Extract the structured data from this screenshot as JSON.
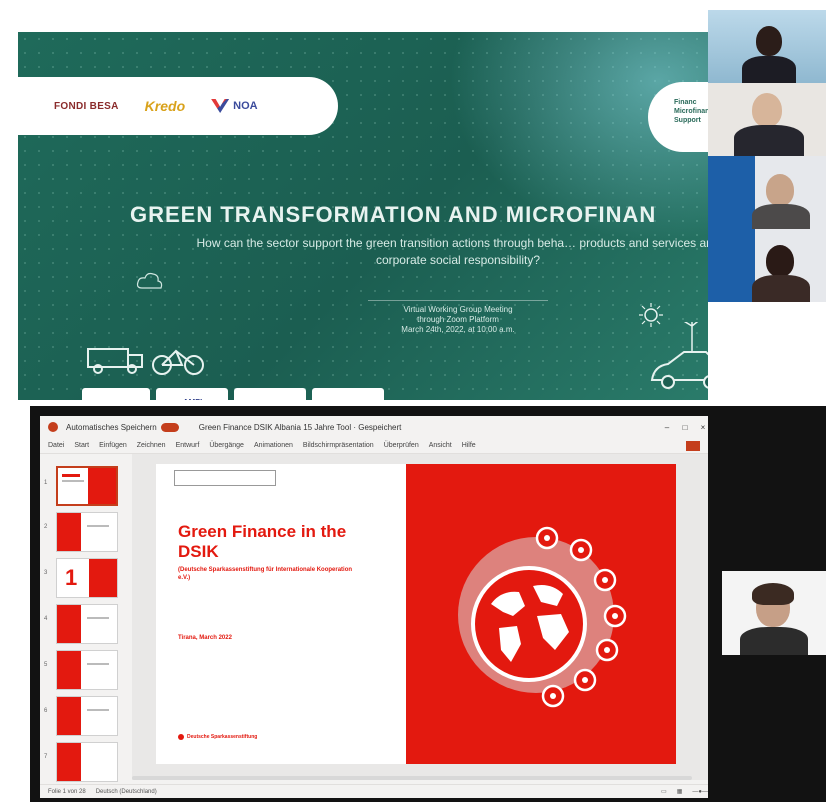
{
  "top_slide": {
    "logos": [
      "FONDI BESA",
      "Kredo",
      "NOA"
    ],
    "title": "GREEN TRANSFORMATION AND MICROFINAN",
    "subtitle": "How can the sector support the green transition actions through beha… products and services and corporate social responsibility?",
    "meeting_lines": [
      "Virtual Working Group Meeting",
      "through Zoom Platform",
      "March 24th, 2022, at 10:00 a.m."
    ],
    "partners": [
      "",
      "AMFI",
      "",
      ""
    ],
    "right_pill": [
      "Financ",
      "Microfinanc",
      "Support"
    ]
  },
  "participants_top": [
    {
      "name": "participant-1"
    },
    {
      "name": "participant-2"
    },
    {
      "name": "participant-3"
    },
    {
      "name": "participant-4"
    }
  ],
  "ppt": {
    "title_bar": {
      "app": "Automatisches Speichern",
      "doc": "Green Finance DSIK Albania 15 Jahre Tool · Gespeichert",
      "user": ""
    },
    "menu": [
      "Datei",
      "Start",
      "Einfügen",
      "Zeichnen",
      "Entwurf",
      "Übergänge",
      "Animationen",
      "Bildschirmpräsentation",
      "Überprüfen",
      "Ansicht",
      "Hilfe"
    ],
    "thumb_numbers": [
      "1",
      "2",
      "3",
      "4",
      "5",
      "6",
      "7"
    ],
    "slide": {
      "title": "Green Finance in the DSIK",
      "subtitle": "(Deutsche Sparkassenstiftung für Internationale Kooperation e.V.)",
      "date": "Tirana, March 2022",
      "footer": "Deutsche Sparkassenstiftung",
      "box": ""
    },
    "big_number": "1",
    "status": [
      "Folie 1 von 28",
      "Deutsch (Deutschland)"
    ]
  },
  "colors": {
    "slide_green": "#1f6a5a",
    "sparkasse_red": "#e3190f",
    "ppt_accent": "#c43e1c"
  }
}
